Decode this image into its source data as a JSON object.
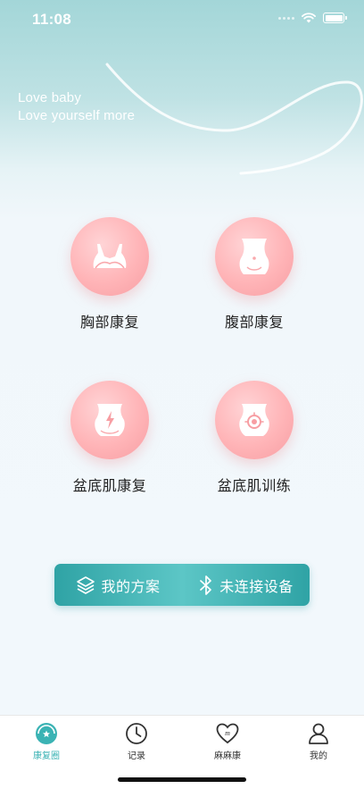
{
  "status_bar": {
    "time": "11:08"
  },
  "banner": {
    "line1": "Love baby",
    "line2": "Love yourself more"
  },
  "features": [
    {
      "label": "胸部康复",
      "icon": "bra-icon"
    },
    {
      "label": "腹部康复",
      "icon": "abdomen-icon"
    },
    {
      "label": "盆底肌康复",
      "icon": "pelvic-energy-icon"
    },
    {
      "label": "盆底肌训练",
      "icon": "pelvic-training-icon"
    }
  ],
  "action_bar": {
    "plan_label": "我的方案",
    "device_label": "未连接设备"
  },
  "tabs": [
    {
      "label": "康复圈",
      "icon": "badge-star-icon",
      "active": true
    },
    {
      "label": "记录",
      "icon": "clock-icon",
      "active": false
    },
    {
      "label": "麻麻康",
      "icon": "heart-m-icon",
      "active": false
    },
    {
      "label": "我的",
      "icon": "person-icon",
      "active": false
    }
  ],
  "colors": {
    "accent": "#3bb3b4",
    "feature_circle": "#ffb4b7",
    "action_bar": "#2fa3a5"
  }
}
